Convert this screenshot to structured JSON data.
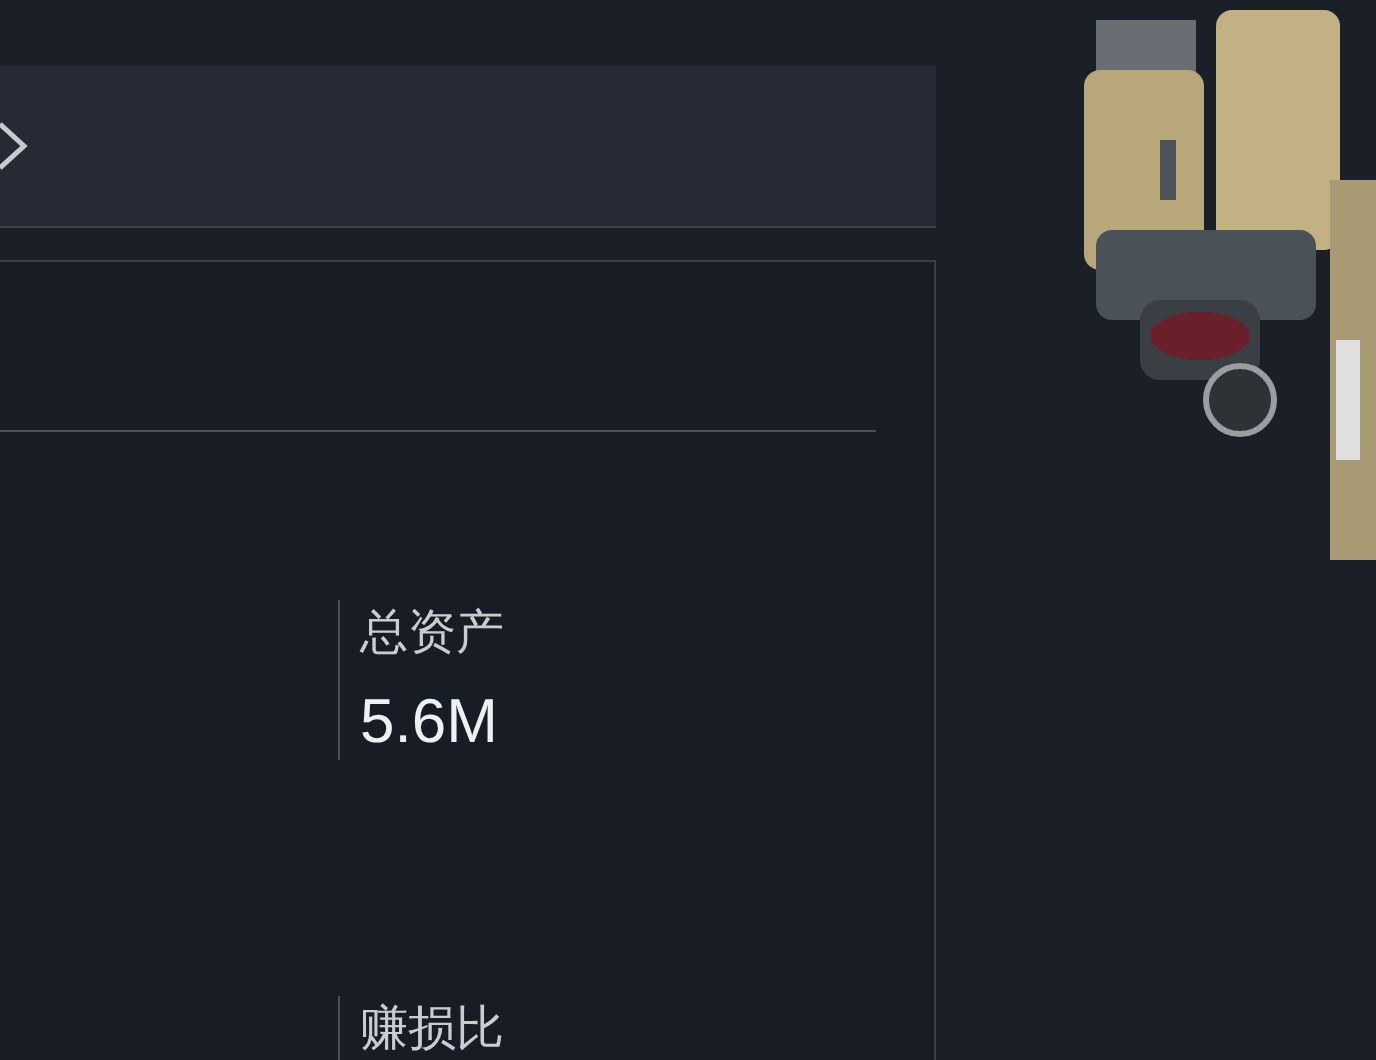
{
  "stats": [
    {
      "label": "总资产",
      "value": "5.6M"
    },
    {
      "label": "赚损比"
    }
  ]
}
